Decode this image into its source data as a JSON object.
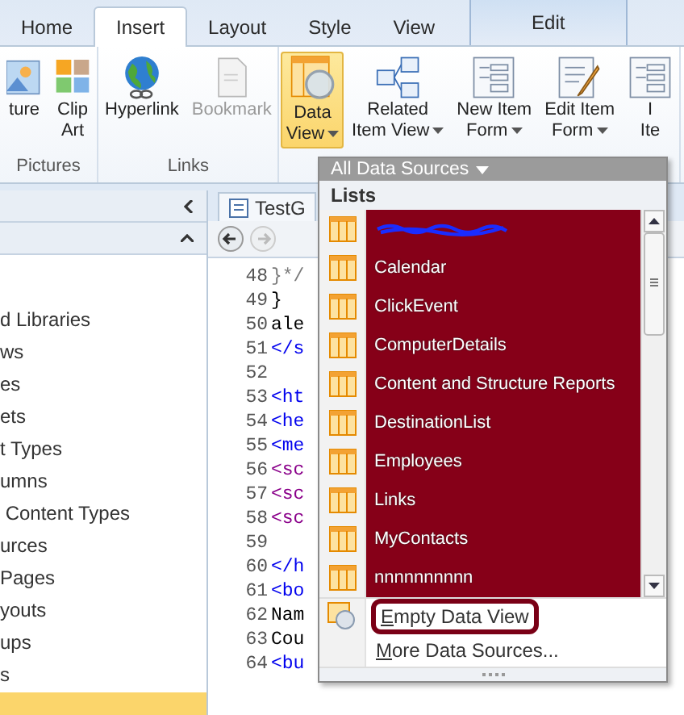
{
  "tabs": [
    {
      "label": "Home",
      "selected": false,
      "contextual": false
    },
    {
      "label": "Insert",
      "selected": true,
      "contextual": false
    },
    {
      "label": "Layout",
      "selected": false,
      "contextual": false
    },
    {
      "label": "Style",
      "selected": false,
      "contextual": false
    },
    {
      "label": "View",
      "selected": false,
      "contextual": false
    },
    {
      "label": "Edit",
      "selected": false,
      "contextual": true
    }
  ],
  "ribbon_groups": [
    {
      "label": "Pictures",
      "buttons": [
        {
          "kind": "picture",
          "lines": [
            "ture"
          ],
          "dropdown": false,
          "disabled": false,
          "selected": false
        },
        {
          "kind": "clipart",
          "lines": [
            "Clip",
            "Art"
          ],
          "dropdown": false,
          "disabled": false,
          "selected": false
        }
      ]
    },
    {
      "label": "Links",
      "buttons": [
        {
          "kind": "hyperlink",
          "lines": [
            "Hyperlink"
          ],
          "dropdown": false,
          "disabled": false,
          "selected": false
        },
        {
          "kind": "bookmark",
          "lines": [
            "Bookmark"
          ],
          "dropdown": false,
          "disabled": true,
          "selected": false
        }
      ]
    },
    {
      "buttons": [
        {
          "kind": "dataview",
          "lines": [
            "Data",
            "View"
          ],
          "dropdown": true,
          "disabled": false,
          "selected": true
        },
        {
          "kind": "related",
          "lines": [
            "Related",
            "Item View"
          ],
          "dropdown": true,
          "disabled": false,
          "selected": false
        },
        {
          "kind": "form",
          "lines": [
            "New Item",
            "Form"
          ],
          "dropdown": true,
          "disabled": false,
          "selected": false
        },
        {
          "kind": "editform",
          "lines": [
            "Edit Item",
            "Form"
          ],
          "dropdown": true,
          "disabled": false,
          "selected": false
        },
        {
          "kind": "form",
          "lines": [
            "I",
            "Ite"
          ],
          "dropdown": false,
          "disabled": false,
          "selected": false
        }
      ]
    }
  ],
  "navigation": {
    "items": [
      {
        "label": "d Libraries",
        "selected": false
      },
      {
        "label": "ws",
        "selected": false
      },
      {
        "label": "es",
        "selected": false
      },
      {
        "label": "ets",
        "selected": false
      },
      {
        "label": "t Types",
        "selected": false
      },
      {
        "label": "umns",
        "selected": false
      },
      {
        "label": " Content Types",
        "selected": false
      },
      {
        "label": "urces",
        "selected": false
      },
      {
        "label": "Pages",
        "selected": false
      },
      {
        "label": "youts",
        "selected": false
      },
      {
        "label": "ups",
        "selected": false
      },
      {
        "label": "s",
        "selected": false
      },
      {
        "selected": true
      }
    ]
  },
  "editor": {
    "tab_label": "TestG",
    "lines": [
      {
        "number": "48",
        "code": "}*/",
        "kind": "comment"
      },
      {
        "number": "49",
        "code": "}",
        "kind": "text"
      },
      {
        "number": "50",
        "code": "ale",
        "kind": "text"
      },
      {
        "number": "51",
        "code": "</s",
        "kind": "tag"
      },
      {
        "number": "52"
      },
      {
        "number": "53",
        "code": "<ht",
        "kind": "tag"
      },
      {
        "number": "54",
        "code": "<he",
        "kind": "tag"
      },
      {
        "number": "55",
        "code": "<me",
        "kind": "tag"
      },
      {
        "number": "56",
        "code": "<sc",
        "kind": "script"
      },
      {
        "number": "57",
        "code": "<sc",
        "kind": "script"
      },
      {
        "number": "58",
        "code": "<sc",
        "kind": "script"
      },
      {
        "number": "59"
      },
      {
        "number": "60",
        "code": "</h",
        "kind": "tag"
      },
      {
        "number": "61",
        "code": "<bo",
        "kind": "tag"
      },
      {
        "number": "62",
        "code": "Nam",
        "kind": "text"
      },
      {
        "number": "63",
        "code": "Cou",
        "kind": "text"
      },
      {
        "number": "64",
        "code": "<bu",
        "kind": "tag"
      }
    ]
  },
  "data_view_menu": {
    "header": "All Data Sources",
    "section": "Lists",
    "lists": [
      {
        "redacted": true,
        "highlighted": true
      },
      {
        "label": "Calendar",
        "redacted": false,
        "highlighted": true
      },
      {
        "label": "ClickEvent",
        "redacted": false,
        "highlighted": true
      },
      {
        "label": "ComputerDetails",
        "redacted": false,
        "highlighted": true
      },
      {
        "label": "Content and Structure Reports",
        "redacted": false,
        "highlighted": true
      },
      {
        "label": "DestinationList",
        "redacted": false,
        "highlighted": true
      },
      {
        "label": "Employees",
        "redacted": false,
        "highlighted": true
      },
      {
        "label": "Links",
        "redacted": false,
        "highlighted": true
      },
      {
        "label": "MyContacts",
        "redacted": false,
        "highlighted": true
      },
      {
        "label": "nnnnnnnnnn",
        "redacted": false,
        "highlighted": true
      }
    ],
    "actions": [
      {
        "label": "Empty Data View",
        "outlined": true,
        "kind": "empty"
      },
      {
        "label": "More Data Sources...",
        "outlined": false,
        "kind": "more"
      }
    ]
  }
}
